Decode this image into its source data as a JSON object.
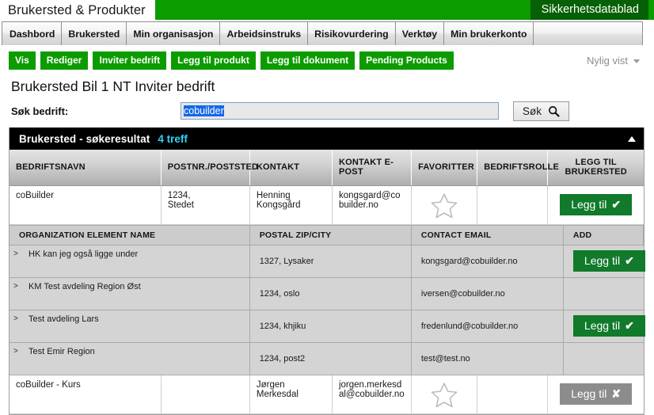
{
  "brand": {
    "title": "Brukersted & Produkter",
    "tab_label": "Sikkerhetsdatablad",
    "green": "#0a9c00",
    "tab_green": "#066006"
  },
  "nav": {
    "items": [
      {
        "label": "Dashbord"
      },
      {
        "label": "Brukersted"
      },
      {
        "label": "Min organisasjon"
      },
      {
        "label": "Arbeidsinstruks"
      },
      {
        "label": "Risikovurdering"
      },
      {
        "label": "Verktøy"
      },
      {
        "label": "Min brukerkonto"
      }
    ]
  },
  "toolbar": {
    "buttons": [
      {
        "label": "Vis"
      },
      {
        "label": "Rediger"
      },
      {
        "label": "Inviter bedrift"
      },
      {
        "label": "Legg til produkt"
      },
      {
        "label": "Legg til dokument"
      },
      {
        "label": "Pending Products"
      }
    ],
    "recent_label": "Nylig vist",
    "recent_icon": "chevron-down-icon",
    "button_color": "#0c9c00"
  },
  "page": {
    "title": "Brukersted Bil 1 NT Inviter bedrift",
    "search_label": "Søk bedrift:",
    "search_value": "cobuilder",
    "search_placeholder": "",
    "search_button_label": "Søk",
    "search_button_icon": "search-icon"
  },
  "results_panel": {
    "title": "Brukersted - søkeresultat",
    "count_label": "4 treff",
    "count_color": "#2fd3f5",
    "collapse_icon": "caret-up-icon"
  },
  "main_table": {
    "columns": [
      "BEDRIFTSNAVN",
      "POSTNR./POSTSTED",
      "KONTAKT",
      "KONTAKT E-POST",
      "FAVORITTER",
      "BEDRIFTSROLLE",
      "LEGG TIL BRUKERSTED"
    ],
    "rows": [
      {
        "name": "coBuilder",
        "zip": "1234,",
        "city": "Stedet",
        "contact_first": "Henning",
        "contact_last": "Kongsgård",
        "email": "kongsgard@cobuilder.no",
        "favorite_icon": "star-outline-icon",
        "role": "",
        "add_label": "Legg til",
        "add_glyph": "✔",
        "add_enabled": true
      },
      {
        "name": "coBuilder - Kurs",
        "zip": "",
        "city": "",
        "contact_first": "Jørgen Merkesdal",
        "contact_last": "",
        "email": "jorgen.merkesdal@cobuilder.no",
        "favorite_icon": "star-outline-icon",
        "role": "",
        "add_label": "Legg til",
        "add_glyph": "✘",
        "add_enabled": false
      }
    ]
  },
  "sub_table": {
    "columns": [
      "ORGANIZATION ELEMENT NAME",
      "POSTAL ZIP/CITY",
      "CONTACT EMAIL",
      "ADD"
    ],
    "rows": [
      {
        "expander": ">",
        "name": "HK kan jeg også ligge under",
        "zipcity": "1327, Lysaker",
        "email": "kongsgard@cobuilder.no",
        "add_label": "Legg til",
        "add_glyph": "✔",
        "add_enabled": true
      },
      {
        "expander": ">",
        "name": "KM Test avdeling Region Øst",
        "zipcity": "1234, oslo",
        "email": "iversen@cobuilder.no",
        "add_label": "",
        "add_glyph": "",
        "add_enabled": false
      },
      {
        "expander": ">",
        "name": "Test avdeling Lars",
        "zipcity": "1234, khjiku",
        "email": "fredenlund@cobuilder.no",
        "add_label": "Legg til",
        "add_glyph": "✔",
        "add_enabled": true
      },
      {
        "expander": ">",
        "name": "Test Emir Region",
        "zipcity": "1234, post2",
        "email": "test@test.no",
        "add_label": "",
        "add_glyph": "",
        "add_enabled": false
      }
    ]
  }
}
